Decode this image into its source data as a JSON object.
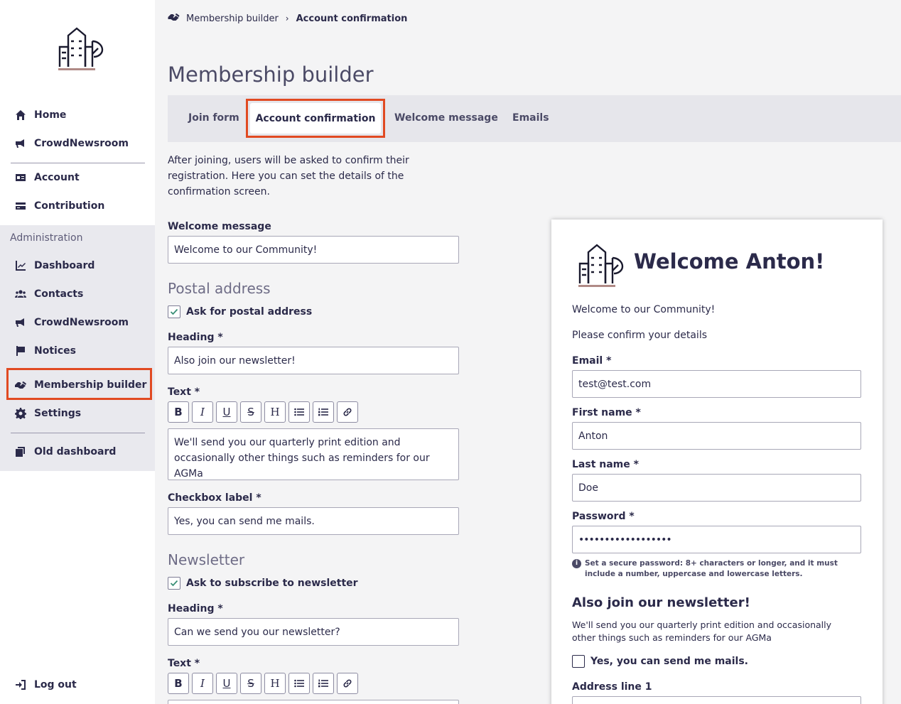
{
  "sidebar": {
    "nav_top": [
      {
        "label": "Home",
        "icon": "home-icon"
      },
      {
        "label": "CrowdNewsroom",
        "icon": "megaphone-icon"
      }
    ],
    "nav_account": [
      {
        "label": "Account",
        "icon": "id-card-icon"
      },
      {
        "label": "Contribution",
        "icon": "credit-card-icon"
      }
    ],
    "admin_title": "Administration",
    "nav_admin": [
      {
        "label": "Dashboard",
        "icon": "chart-line-icon"
      },
      {
        "label": "Contacts",
        "icon": "users-icon"
      },
      {
        "label": "CrowdNewsroom",
        "icon": "megaphone-icon"
      },
      {
        "label": "Notices",
        "icon": "flag-icon"
      },
      {
        "label": "Membership builder",
        "icon": "handshake-icon"
      },
      {
        "label": "Settings",
        "icon": "gear-icon"
      }
    ],
    "old_dashboard": "Old dashboard",
    "logout": "Log out"
  },
  "breadcrumb": {
    "parent": "Membership builder",
    "separator": "›",
    "current": "Account confirmation"
  },
  "page_title": "Membership builder",
  "tabs": [
    {
      "label": "Join form"
    },
    {
      "label": "Account confirmation",
      "active": true
    },
    {
      "label": "Welcome message"
    },
    {
      "label": "Emails"
    }
  ],
  "intro": "After joining, users will be asked to confirm their registration. Here you can set the details of the confirmation screen.",
  "form": {
    "welcome_label": "Welcome message",
    "welcome_value": "Welcome to our Community!",
    "postal": {
      "section": "Postal address",
      "ask_label": "Ask for postal address",
      "heading_label": "Heading *",
      "heading_value": "Also join our newsletter!",
      "text_label": "Text *",
      "text_value": "We'll send you our quarterly print edition and occasionally other things such as reminders for our AGMa",
      "checkbox_label": "Checkbox label *",
      "checkbox_value": "Yes, you can send me mails."
    },
    "newsletter": {
      "section": "Newsletter",
      "ask_label": "Ask to subscribe to newsletter",
      "heading_label": "Heading *",
      "heading_value": "Can we send you our newsletter?",
      "text_label": "Text *"
    },
    "toolbar": [
      "B",
      "I",
      "U",
      "S",
      "H"
    ]
  },
  "preview": {
    "title": "Welcome Anton!",
    "welcome": "Welcome to our Community!",
    "confirm": "Please confirm your details",
    "email_label": "Email *",
    "email_value": "test@test.com",
    "first_label": "First name *",
    "first_value": "Anton",
    "last_label": "Last name *",
    "last_value": "Doe",
    "password_label": "Password *",
    "password_value": "••••••••••••••••••",
    "password_hint": "Set a secure password: 8+ characters or longer, and it must include a number, uppercase and lowercase letters.",
    "newsletter_heading": "Also join our newsletter!",
    "newsletter_text": "We'll send you our quarterly print edition and occasionally other things such as reminders for our AGMa",
    "mail_check": "Yes, you can send me mails.",
    "address_label": "Address line 1"
  },
  "colors": {
    "highlight": "#e14a22",
    "text": "#2b2a4a",
    "sidebar_admin_bg": "#e9e9ee"
  }
}
